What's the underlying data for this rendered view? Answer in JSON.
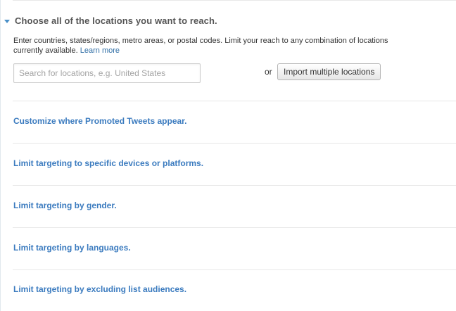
{
  "locations": {
    "title": "Choose all of the locations you want to reach.",
    "help_text": "Enter countries, states/regions, metro areas, or postal codes. Limit your reach to any combination of locations currently available.",
    "learn_more": "Learn more",
    "search_placeholder": "Search for locations, e.g. United States",
    "or_text": "or",
    "import_button": "Import multiple locations"
  },
  "sections": [
    {
      "label": "Customize where Promoted Tweets appear."
    },
    {
      "label": "Limit targeting to specific devices or platforms."
    },
    {
      "label": "Limit targeting by gender."
    },
    {
      "label": "Limit targeting by languages."
    },
    {
      "label": "Limit targeting by excluding list audiences."
    }
  ],
  "colors": {
    "link": "#3b7bbf",
    "heading": "#555555",
    "divider": "#e8e8e8",
    "caret": "#4a90c8"
  }
}
